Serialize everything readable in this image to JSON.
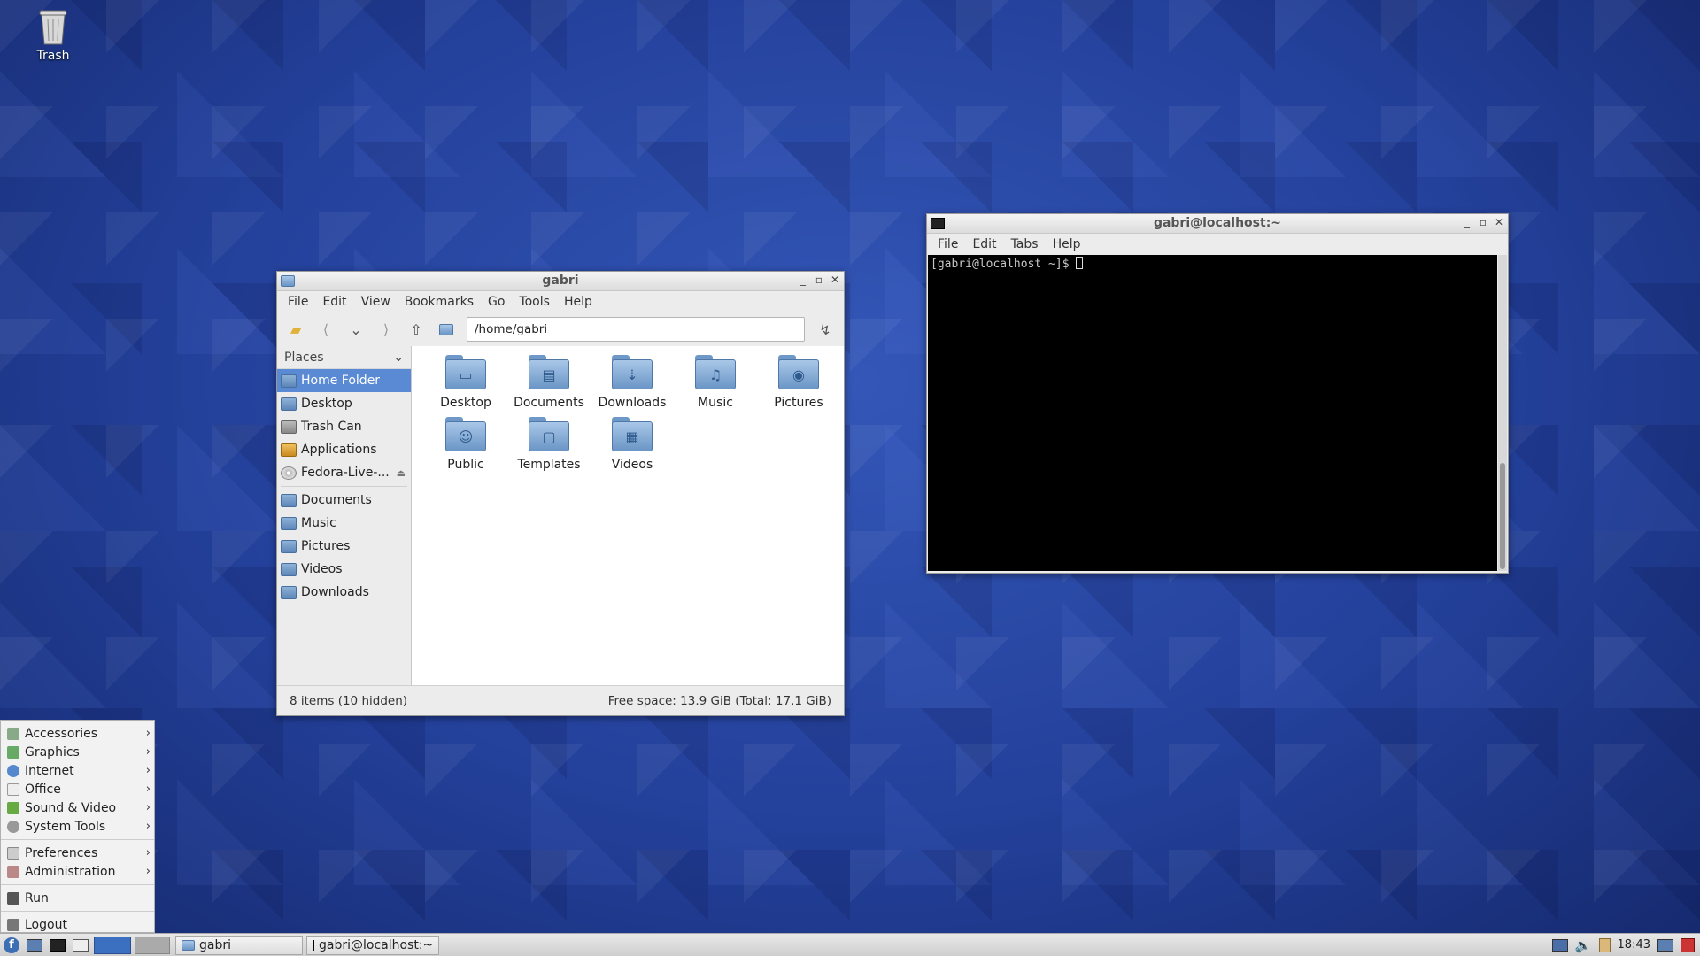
{
  "desktop": {
    "trash_label": "Trash"
  },
  "file_manager": {
    "title": "gabri",
    "menu": [
      "File",
      "Edit",
      "View",
      "Bookmarks",
      "Go",
      "Tools",
      "Help"
    ],
    "path": "/home/gabri",
    "places_label": "Places",
    "places": [
      {
        "label": "Home Folder",
        "icon": "home-folder-icon",
        "selected": true
      },
      {
        "label": "Desktop",
        "icon": "folder-icon"
      },
      {
        "label": "Trash Can",
        "icon": "trash-icon"
      },
      {
        "label": "Applications",
        "icon": "applications-icon"
      },
      {
        "label": "Fedora-Live-...",
        "icon": "disc-icon"
      }
    ],
    "bookmarks": [
      "Documents",
      "Music",
      "Pictures",
      "Videos",
      "Downloads"
    ],
    "items": [
      {
        "label": "Desktop",
        "glyph": "▭"
      },
      {
        "label": "Documents",
        "glyph": "▤"
      },
      {
        "label": "Downloads",
        "glyph": "⇣"
      },
      {
        "label": "Music",
        "glyph": "♫"
      },
      {
        "label": "Pictures",
        "glyph": "◉"
      },
      {
        "label": "Public",
        "glyph": "☺"
      },
      {
        "label": "Templates",
        "glyph": "▢"
      },
      {
        "label": "Videos",
        "glyph": "▦"
      }
    ],
    "status_left": "8 items (10 hidden)",
    "status_right": "Free space: 13.9 GiB (Total: 17.1 GiB)"
  },
  "terminal": {
    "title": "gabri@localhost:~",
    "menu": [
      "File",
      "Edit",
      "Tabs",
      "Help"
    ],
    "prompt": "[gabri@localhost ~]$ "
  },
  "start_menu": {
    "group1": [
      "Accessories",
      "Graphics",
      "Internet",
      "Office",
      "Sound & Video",
      "System Tools"
    ],
    "group2": [
      "Preferences",
      "Administration"
    ],
    "run": "Run",
    "logout": "Logout"
  },
  "taskbar": {
    "tasks": [
      "gabri",
      "gabri@localhost:~"
    ],
    "clock": "18:43"
  }
}
